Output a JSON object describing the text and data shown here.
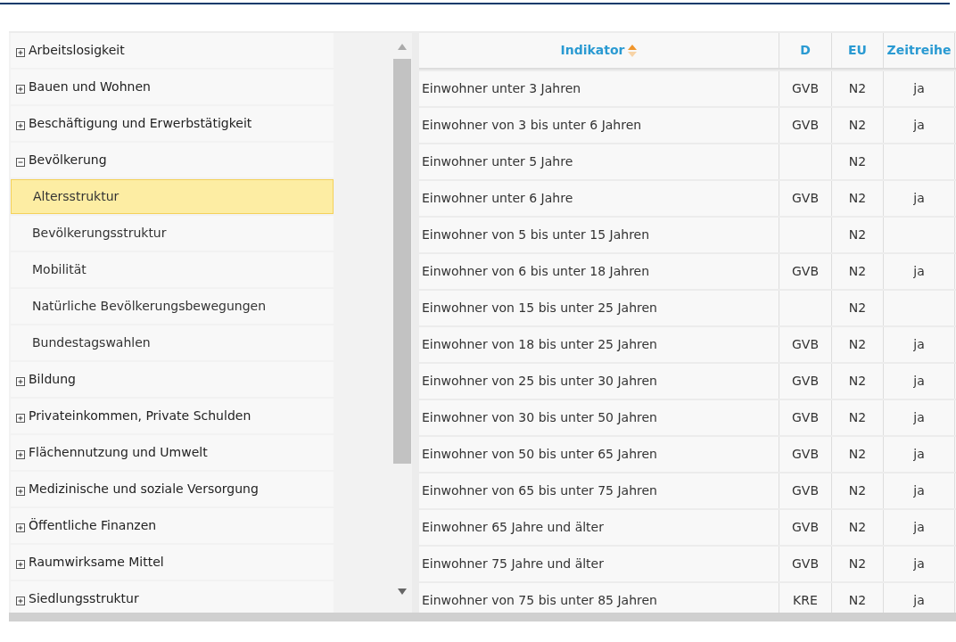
{
  "tree": [
    {
      "label": "Arbeitslosigkeit",
      "expanded": false,
      "selected": false
    },
    {
      "label": "Bauen und Wohnen",
      "expanded": false,
      "selected": false
    },
    {
      "label": "Beschäftigung und Erwerbstätigkeit",
      "expanded": false,
      "selected": false
    },
    {
      "label": "Bevölkerung",
      "expanded": true,
      "selected": false,
      "children": [
        {
          "label": "Altersstruktur",
          "selected": true
        },
        {
          "label": "Bevölkerungsstruktur",
          "selected": false
        },
        {
          "label": "Mobilität",
          "selected": false
        },
        {
          "label": "Natürliche Bevölkerungsbewegungen",
          "selected": false
        },
        {
          "label": "Bundestagswahlen",
          "selected": false
        }
      ]
    },
    {
      "label": "Bildung",
      "expanded": false,
      "selected": false
    },
    {
      "label": "Privateinkommen, Private Schulden",
      "expanded": false,
      "selected": false
    },
    {
      "label": "Flächennutzung und Umwelt",
      "expanded": false,
      "selected": false
    },
    {
      "label": "Medizinische und soziale Versorgung",
      "expanded": false,
      "selected": false
    },
    {
      "label": "Öffentliche Finanzen",
      "expanded": false,
      "selected": false
    },
    {
      "label": "Raumwirksame Mittel",
      "expanded": false,
      "selected": false
    },
    {
      "label": "Siedlungsstruktur",
      "expanded": false,
      "selected": false
    }
  ],
  "table": {
    "columns": [
      {
        "label": "Indikator",
        "sorted": true
      },
      {
        "label": "D",
        "sorted": false
      },
      {
        "label": "EU",
        "sorted": false
      },
      {
        "label": "Zeitreihe",
        "sorted": false
      }
    ],
    "rows": [
      [
        "Einwohner unter 3 Jahren",
        "GVB",
        "N2",
        "ja"
      ],
      [
        "Einwohner von 3 bis unter 6 Jahren",
        "GVB",
        "N2",
        "ja"
      ],
      [
        "Einwohner unter 5 Jahre",
        "",
        "N2",
        ""
      ],
      [
        "Einwohner unter 6 Jahre",
        "GVB",
        "N2",
        "ja"
      ],
      [
        "Einwohner von 5 bis unter 15 Jahren",
        "",
        "N2",
        ""
      ],
      [
        "Einwohner von 6 bis unter 18 Jahren",
        "GVB",
        "N2",
        "ja"
      ],
      [
        "Einwohner von 15 bis unter 25 Jahren",
        "",
        "N2",
        ""
      ],
      [
        "Einwohner von 18 bis unter 25 Jahren",
        "GVB",
        "N2",
        "ja"
      ],
      [
        "Einwohner von 25 bis unter 30 Jahren",
        "GVB",
        "N2",
        "ja"
      ],
      [
        "Einwohner von 30 bis unter 50 Jahren",
        "GVB",
        "N2",
        "ja"
      ],
      [
        "Einwohner von 50 bis unter 65 Jahren",
        "GVB",
        "N2",
        "ja"
      ],
      [
        "Einwohner von 65 bis unter 75 Jahren",
        "GVB",
        "N2",
        "ja"
      ],
      [
        "Einwohner 65 Jahre und älter",
        "GVB",
        "N2",
        "ja"
      ],
      [
        "Einwohner 75 Jahre und älter",
        "GVB",
        "N2",
        "ja"
      ],
      [
        "Einwohner von 75 bis unter 85 Jahren",
        "KRE",
        "N2",
        "ja"
      ]
    ]
  }
}
